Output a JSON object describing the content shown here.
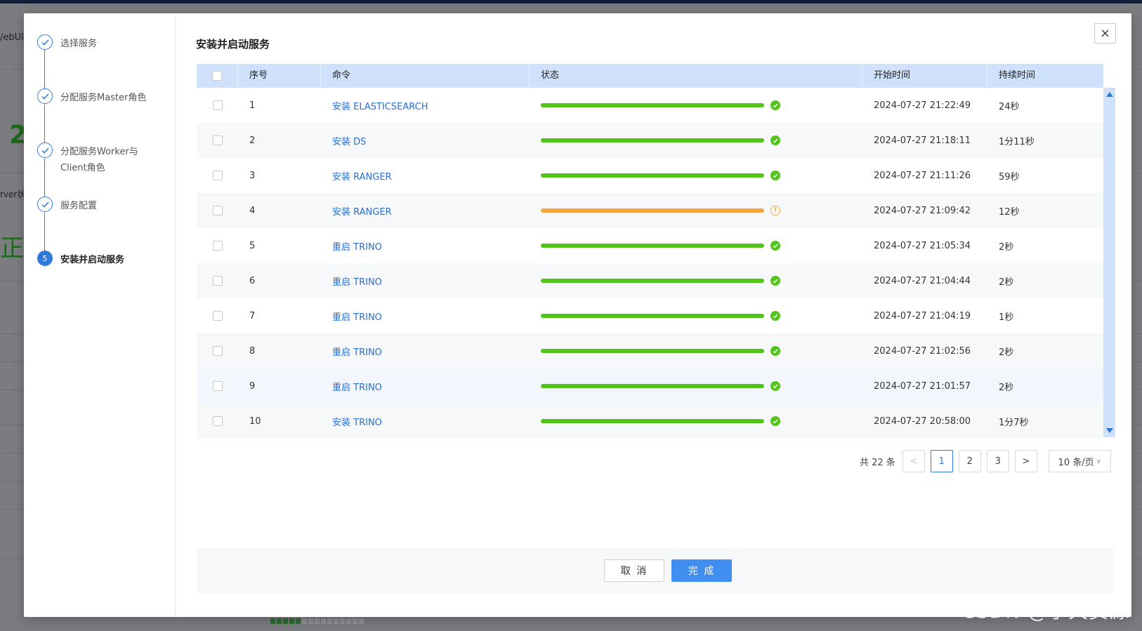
{
  "background": {
    "partial_texts": [
      "/ebUI",
      "2",
      "rver状",
      "正常"
    ],
    "watermark": "CSDN @小天资源"
  },
  "steps": [
    {
      "label": "选择服务",
      "state": "done"
    },
    {
      "label": "分配服务Master角色",
      "state": "done"
    },
    {
      "label": "分配服务Worker与Client角色",
      "state": "done"
    },
    {
      "label": "服务配置",
      "state": "done"
    },
    {
      "label": "安装并启动服务",
      "state": "active",
      "number": "5"
    }
  ],
  "dialog": {
    "title": "安装并启动服务",
    "close_icon": "×"
  },
  "table": {
    "headers": {
      "no": "序号",
      "command": "命令",
      "status": "状态",
      "start_time": "开始时间",
      "duration": "持续时间"
    },
    "rows": [
      {
        "no": "1",
        "command": "安装 ELASTICSEARCH",
        "status": "success",
        "progress": 100,
        "start_time": "2024-07-27 21:22:49",
        "duration": "24秒"
      },
      {
        "no": "2",
        "command": "安装 DS",
        "status": "success",
        "progress": 100,
        "start_time": "2024-07-27 21:18:11",
        "duration": "1分11秒"
      },
      {
        "no": "3",
        "command": "安装 RANGER",
        "status": "success",
        "progress": 100,
        "start_time": "2024-07-27 21:11:26",
        "duration": "59秒"
      },
      {
        "no": "4",
        "command": "安装 RANGER",
        "status": "warning",
        "progress": 100,
        "start_time": "2024-07-27 21:09:42",
        "duration": "12秒"
      },
      {
        "no": "5",
        "command": "重启 TRINO",
        "status": "success",
        "progress": 100,
        "start_time": "2024-07-27 21:05:34",
        "duration": "2秒"
      },
      {
        "no": "6",
        "command": "重启 TRINO",
        "status": "success",
        "progress": 100,
        "start_time": "2024-07-27 21:04:44",
        "duration": "2秒"
      },
      {
        "no": "7",
        "command": "重启 TRINO",
        "status": "success",
        "progress": 100,
        "start_time": "2024-07-27 21:04:19",
        "duration": "1秒"
      },
      {
        "no": "8",
        "command": "重启 TRINO",
        "status": "success",
        "progress": 100,
        "start_time": "2024-07-27 21:02:56",
        "duration": "2秒"
      },
      {
        "no": "9",
        "command": "重启 TRINO",
        "status": "success",
        "progress": 100,
        "start_time": "2024-07-27 21:01:57",
        "duration": "2秒"
      },
      {
        "no": "10",
        "command": "安装 TRINO",
        "status": "success",
        "progress": 100,
        "start_time": "2024-07-27 20:58:00",
        "duration": "1分7秒"
      }
    ]
  },
  "pagination": {
    "total": "共 22 条",
    "prev": "<",
    "pages": [
      "1",
      "2",
      "3"
    ],
    "current": "1",
    "next": ">",
    "page_size": "10 条/页"
  },
  "footer": {
    "cancel": "取 消",
    "finish": "完 成"
  },
  "colors": {
    "primary": "#2f7bd9",
    "success": "#52c41a",
    "warning": "#f5a53d",
    "header_bg": "#cfe1fb"
  }
}
